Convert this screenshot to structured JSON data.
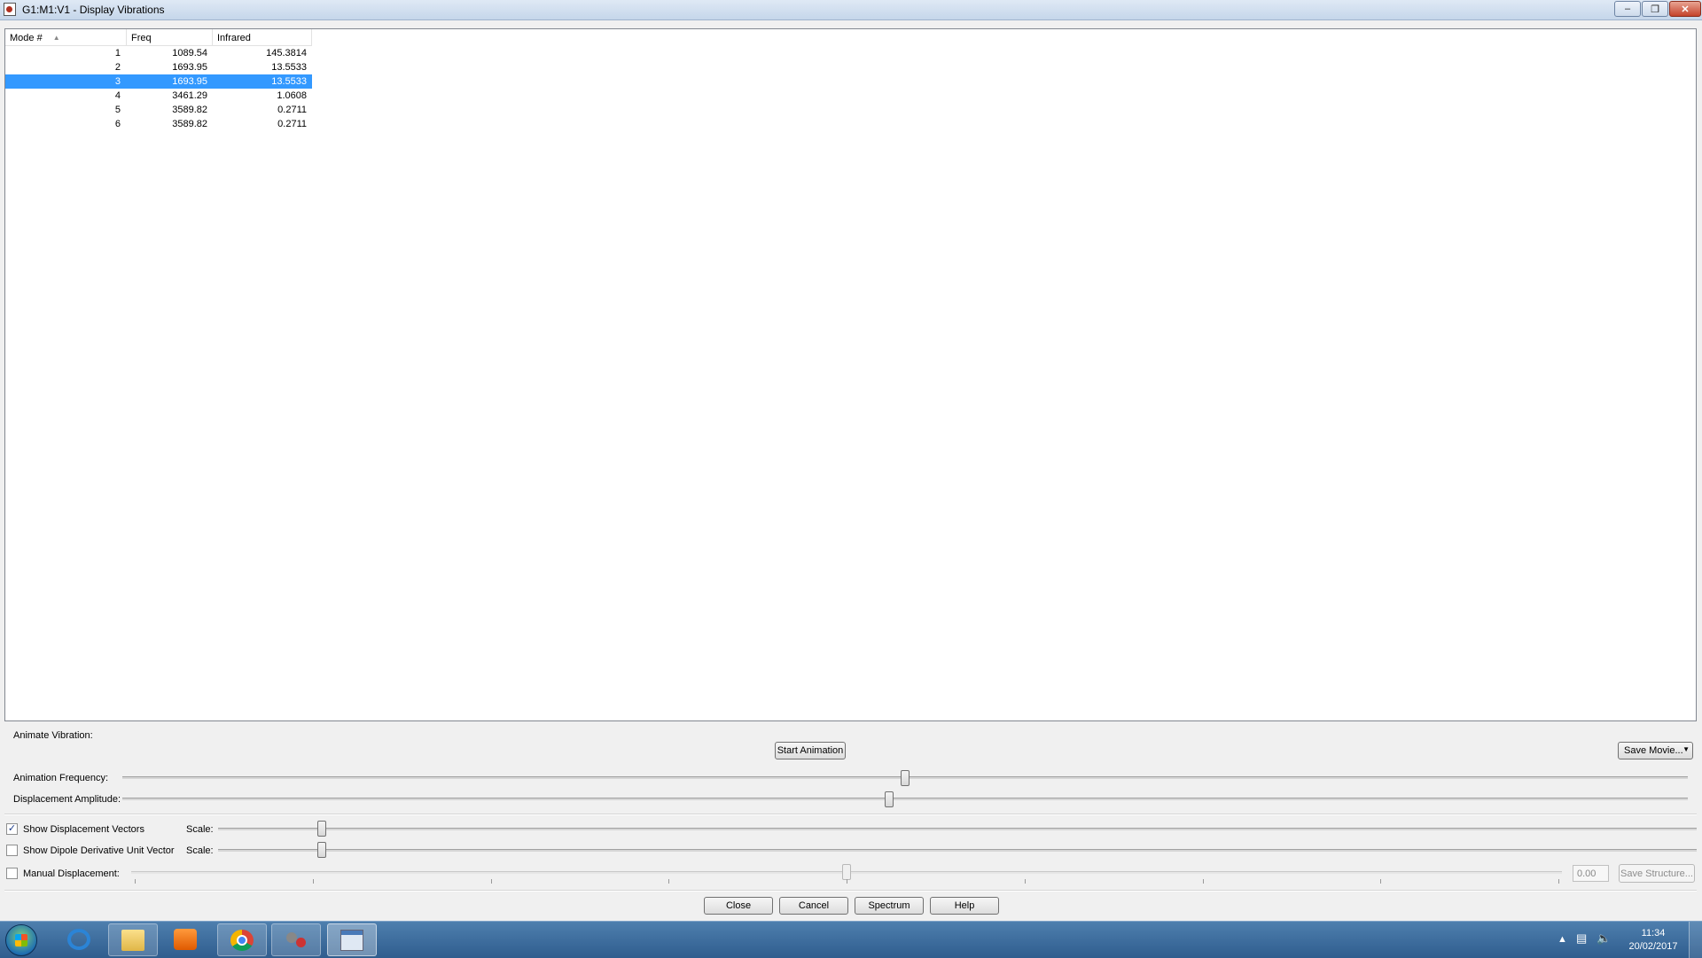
{
  "window": {
    "title": "G1:M1:V1 - Display Vibrations"
  },
  "table": {
    "headers": [
      "Mode #",
      "Freq",
      "Infrared"
    ],
    "rows": [
      {
        "mode": "1",
        "freq": "1089.54",
        "ir": "145.3814"
      },
      {
        "mode": "2",
        "freq": "1693.95",
        "ir": "13.5533"
      },
      {
        "mode": "3",
        "freq": "1693.95",
        "ir": "13.5533",
        "selected": true
      },
      {
        "mode": "4",
        "freq": "3461.29",
        "ir": "1.0608"
      },
      {
        "mode": "5",
        "freq": "3589.82",
        "ir": "0.2711"
      },
      {
        "mode": "6",
        "freq": "3589.82",
        "ir": "0.2711"
      }
    ],
    "selected_row": 3
  },
  "animate": {
    "section_label": "Animate Vibration:",
    "start_button": "Start Animation",
    "save_movie": "Save Movie...",
    "frequency_label": "Animation Frequency:",
    "frequency_level": 0.5,
    "amplitude_label": "Displacement Amplitude:",
    "amplitude_level": 0.49
  },
  "vectors": {
    "show_displacement_label": "Show Displacement Vectors",
    "show_displacement_checked": true,
    "show_dipole_label": "Show Dipole Derivative Unit Vector",
    "show_dipole_checked": false,
    "scale_label": "Scale:",
    "displacement_scale_level": 0.07,
    "dipole_scale_level": 0.07
  },
  "manual": {
    "label": "Manual Displacement:",
    "checked": false,
    "value": "0.00",
    "save_structure": "Save Structure...",
    "level": 0.5
  },
  "footer": {
    "close": "Close",
    "cancel": "Cancel",
    "spectrum": "Spectrum",
    "help": "Help"
  },
  "clock": {
    "time": "11:34",
    "date": "20/02/2017"
  },
  "colors": {
    "selection": "#3399ff",
    "taskbar": "#2f5d8e"
  }
}
